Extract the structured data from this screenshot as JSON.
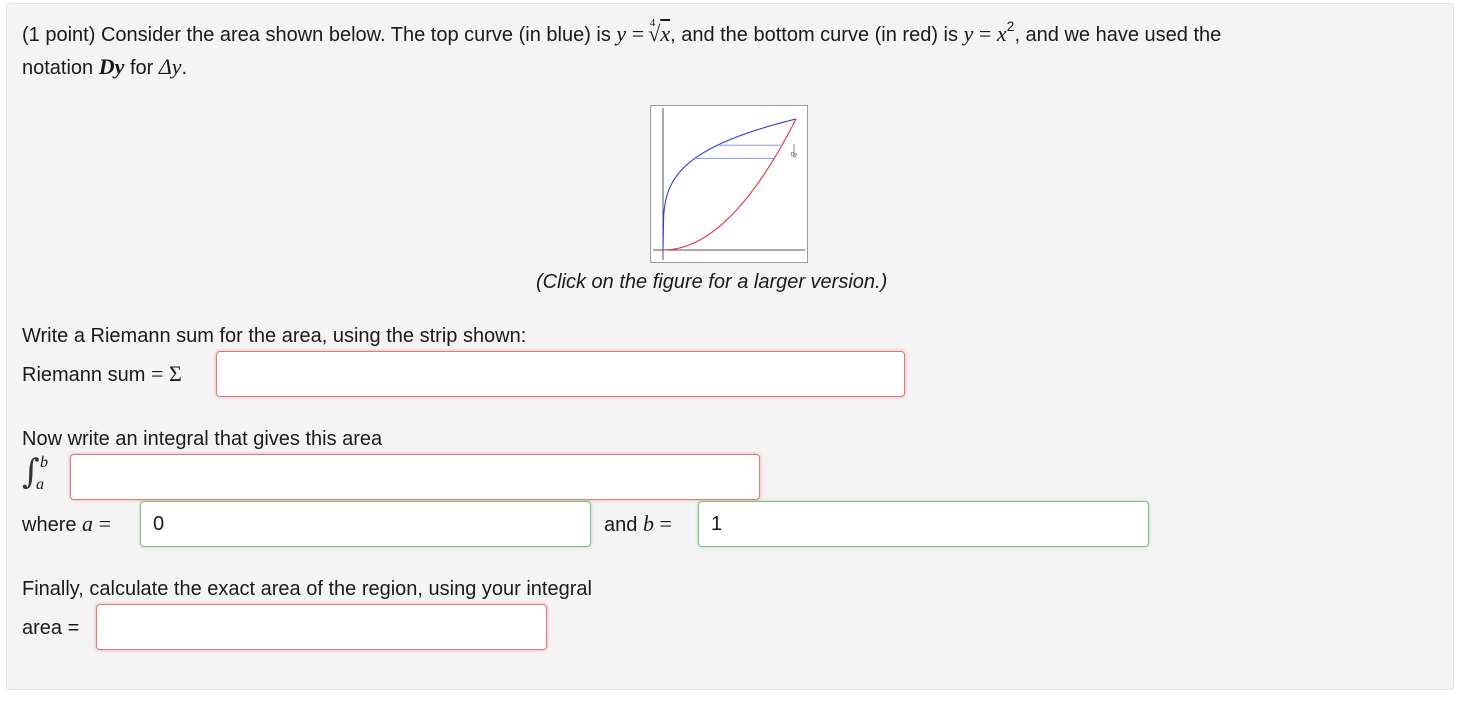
{
  "problem": {
    "points": "(1 point)",
    "intro": "Consider the area shown below. The top curve (in blue) is",
    "top_var": "y",
    "eq": "=",
    "top_root_index": "4",
    "top_radicand": "x",
    "mid": ", and the bottom curve (in red) is",
    "bottom_var": "y",
    "bottom_base": "x",
    "bottom_exp": "2",
    "end": ", and we have used the",
    "notation_prefix": "notation",
    "notation_sym": "Dy",
    "notation_for": "for",
    "delta_sym": "Δy",
    "period": "."
  },
  "figure": {
    "strip_label": "Dy",
    "caption": "(Click on the figure for a larger version.)",
    "colors": {
      "top_curve": "#2b3fe0",
      "bottom_curve": "#e8303a",
      "strip": "#7a86f0"
    }
  },
  "riemann": {
    "prompt": "Write a Riemann sum for the area, using the strip shown:",
    "label": "Riemann sum",
    "eq": "=",
    "sigma": "Σ",
    "value": ""
  },
  "integral": {
    "prompt": "Now write an integral that gives this area",
    "upper": "b",
    "lower": "a",
    "value": ""
  },
  "bounds": {
    "where": "where",
    "a_sym": "a",
    "a_eq": "=",
    "a_value": "0",
    "and": "and",
    "b_sym": "b",
    "b_eq": "=",
    "b_value": "1"
  },
  "area": {
    "prompt": "Finally, calculate the exact area of the region, using your integral",
    "label": "area =",
    "value": ""
  }
}
